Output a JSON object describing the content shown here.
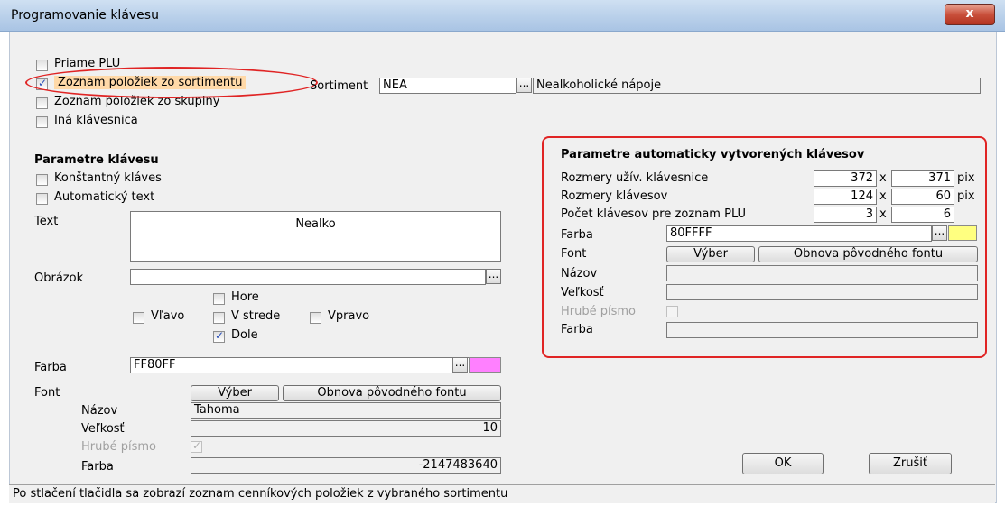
{
  "window": {
    "title": "Programovanie klávesu",
    "close_glyph": "x"
  },
  "top_options": [
    {
      "label": "Priame PLU",
      "checked": false
    },
    {
      "label": "Zoznam položiek zo sortimentu",
      "checked": true
    },
    {
      "label": "Zoznam položiek zo skupiny",
      "checked": false
    },
    {
      "label": "Iná klávesnica",
      "checked": false
    }
  ],
  "sortiment": {
    "label": "Sortiment",
    "code": "NEA",
    "browse": "...",
    "name": "Nealkoholické nápoje"
  },
  "key_params": {
    "heading": "Parametre klávesu",
    "konstantny": {
      "label": "Konštantný kláves",
      "checked": false
    },
    "auto_text": {
      "label": "Automatický text",
      "checked": false
    },
    "text_label": "Text",
    "text_value": "Nealko",
    "image_label": "Obrázok",
    "image_value": "",
    "image_browse": "...",
    "positions": {
      "hore": "Hore",
      "vlavo": "Vľavo",
      "vstrede": "V strede",
      "vpravo": "Vpravo",
      "dole": "Dole",
      "dole_checked": true
    },
    "color_label": "Farba",
    "color_value": "FF80FF",
    "color_swatch": "#ff80ff",
    "color_browse": "...",
    "font_label": "Font",
    "select_button": "Výber",
    "restore_button": "Obnova pôvodného fontu",
    "name_label": "Názov",
    "name_value": "Tahoma",
    "size_label": "Veľkosť",
    "size_value": "10",
    "bold_label": "Hrubé písmo",
    "bold_checked": true,
    "fcolor_label": "Farba",
    "fcolor_value": "-2147483640"
  },
  "auto_params": {
    "heading": "Parametre automaticky vytvorených klávesov",
    "rows": [
      {
        "label": "Rozmery užív. klávesnice",
        "a": "372",
        "sep": "x",
        "b": "371",
        "unit": "pix"
      },
      {
        "label": "Rozmery klávesov",
        "a": "124",
        "sep": "x",
        "b": "60",
        "unit": "pix"
      },
      {
        "label": "Počet klávesov pre zoznam PLU",
        "a": "3",
        "sep": "x",
        "b": "6",
        "unit": ""
      }
    ],
    "color_label": "Farba",
    "color_value": "80FFFF",
    "color_swatch": "#ffff80",
    "color_browse": "...",
    "font_label": "Font",
    "select_button": "Výber",
    "restore_button": "Obnova pôvodného fontu",
    "name_label": "Názov",
    "size_label": "Veľkosť",
    "bold_label": "Hrubé písmo",
    "fcolor_label": "Farba"
  },
  "buttons": {
    "ok": "OK",
    "cancel": "Zrušiť"
  },
  "status": "Po stlačení tlačidla sa zobrazí zoznam cenníkových položiek z vybraného sortimentu"
}
